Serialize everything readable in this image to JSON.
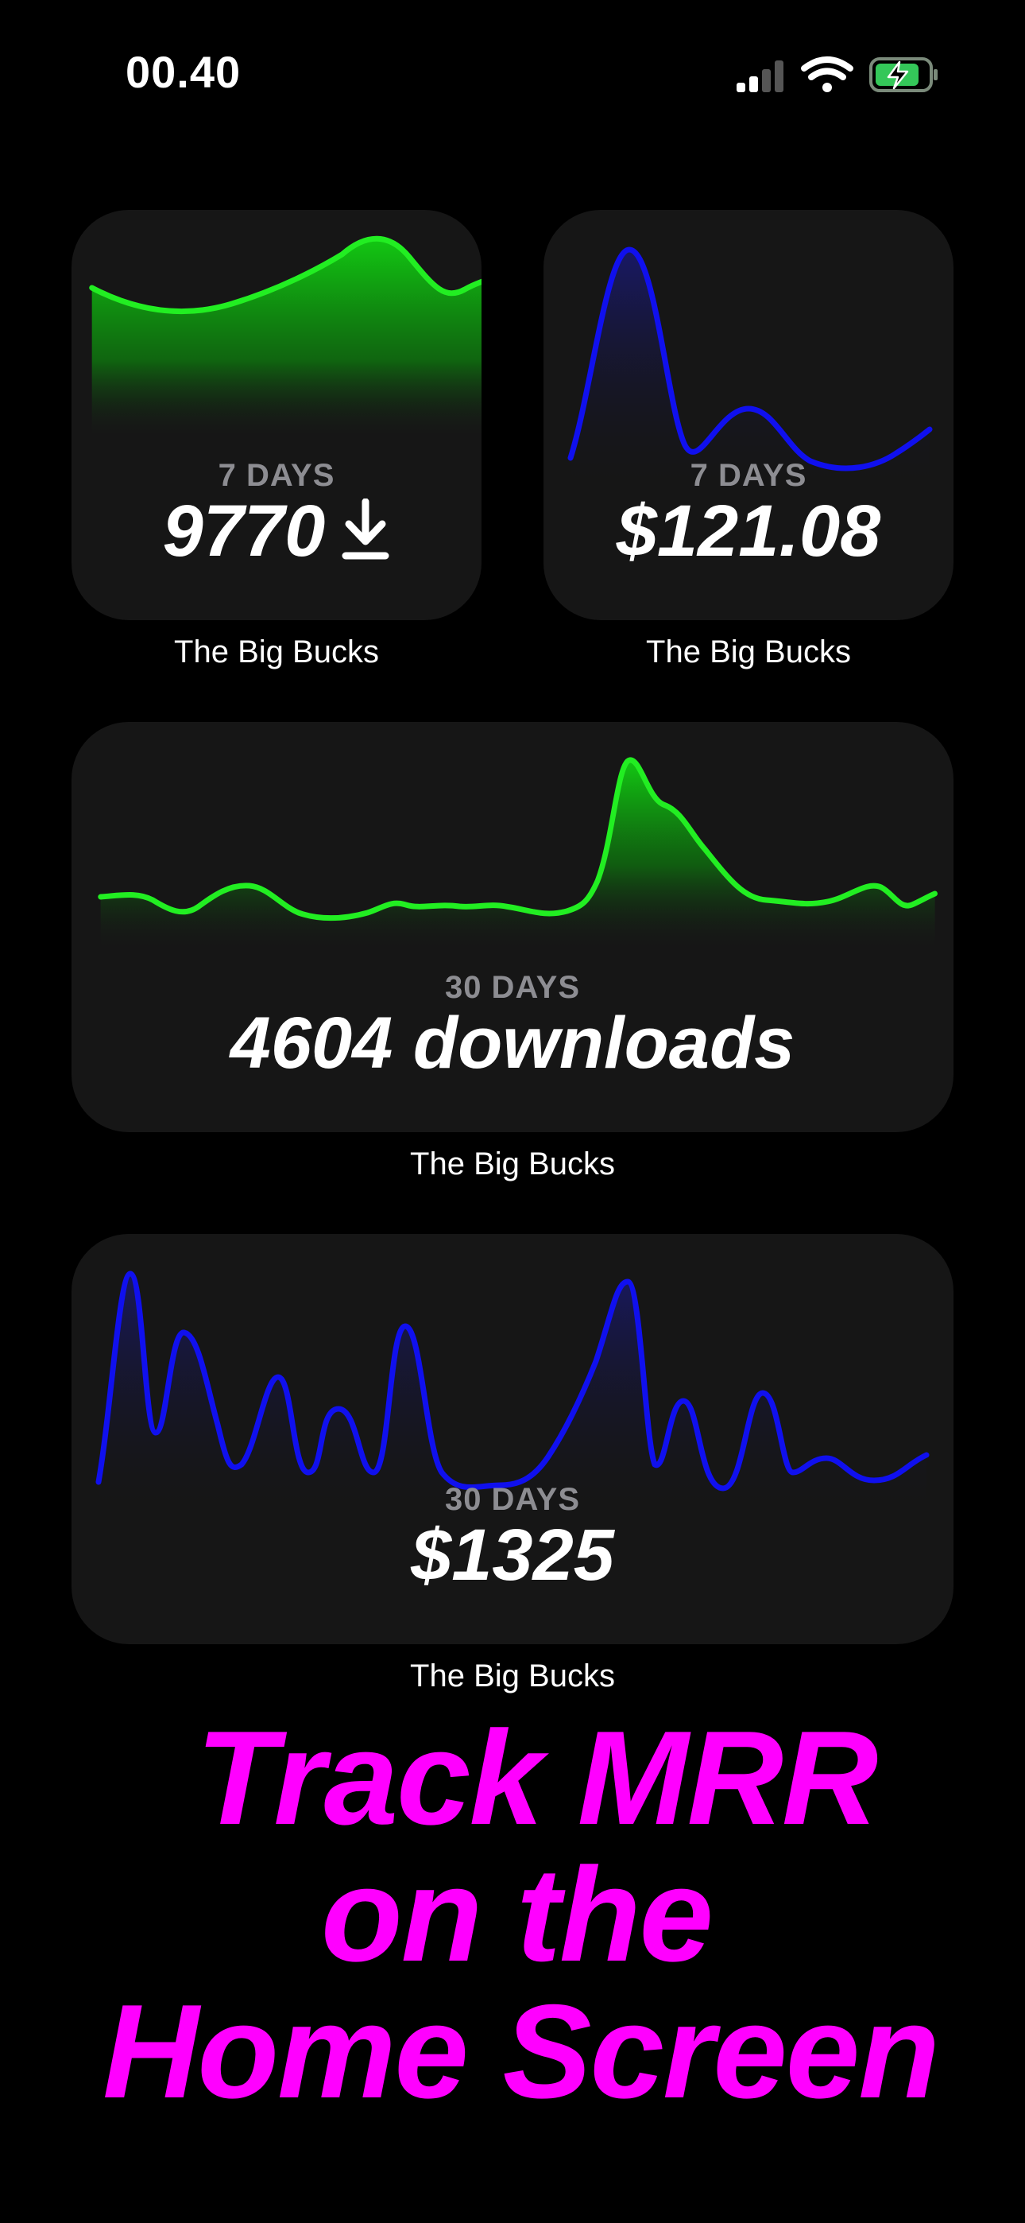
{
  "status_bar": {
    "time": "00.40",
    "icons": [
      "cellular-signal-icon",
      "wifi-icon",
      "battery-charging-icon"
    ]
  },
  "colors": {
    "green_series": "#22ee22",
    "blue_series": "#1010ee",
    "headline": "#ff00ff",
    "widget_bg": "#161616",
    "period_text": "#8d8d92"
  },
  "widgets": [
    {
      "period": "7 DAYS",
      "value": "9770",
      "value_icon": "download-arrow-icon",
      "caption": "The Big Bucks",
      "chart_type": "area",
      "color": "#22ee22"
    },
    {
      "period": "7 DAYS",
      "value": "$121.08",
      "caption": "The Big Bucks",
      "chart_type": "line",
      "color": "#1010ee"
    },
    {
      "period": "30 DAYS",
      "value": "4604 downloads",
      "caption": "The Big Bucks",
      "chart_type": "area",
      "color": "#22ee22"
    },
    {
      "period": "30 DAYS",
      "value": "$1325",
      "caption": "The Big Bucks",
      "chart_type": "line",
      "color": "#1010ee"
    }
  ],
  "headline": {
    "lines": [
      "Track MRR",
      "on the",
      "Home Screen"
    ]
  }
}
